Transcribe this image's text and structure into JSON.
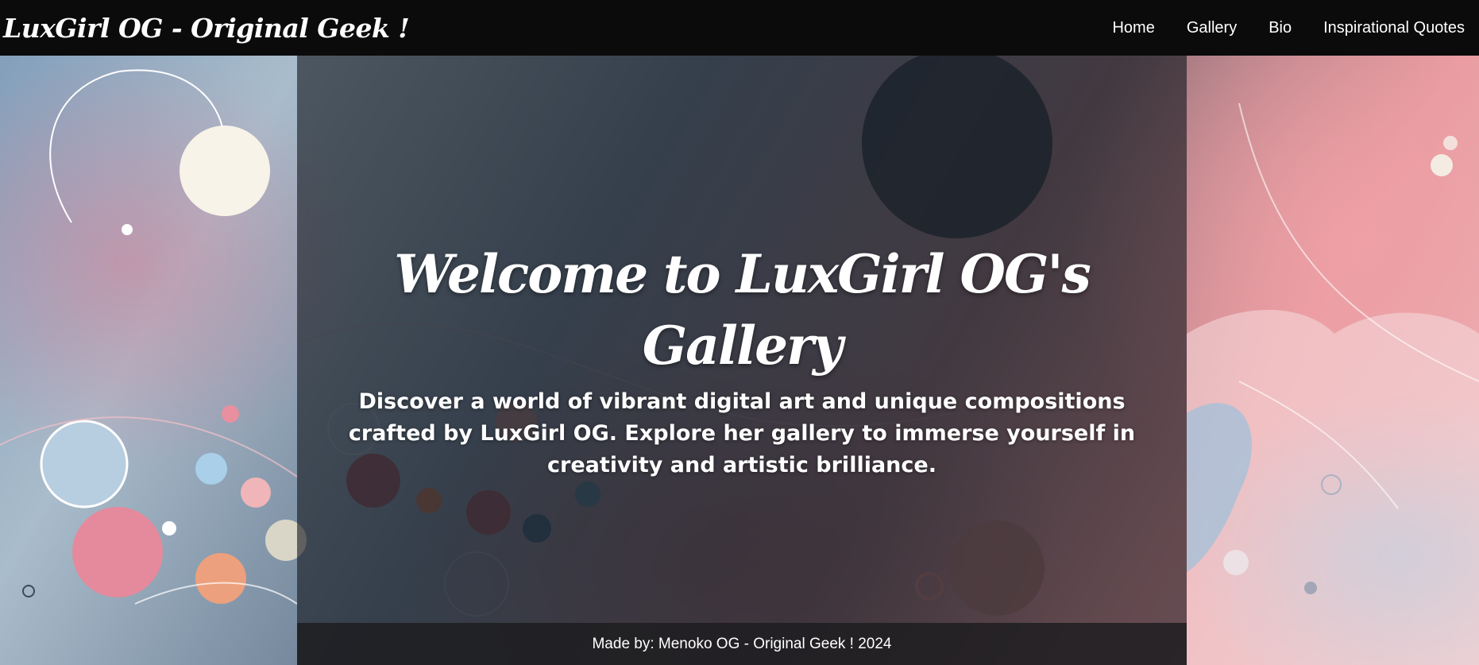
{
  "brand": {
    "title": "LuxGirl OG - Original Geek !"
  },
  "nav": {
    "items": [
      {
        "label": "Home"
      },
      {
        "label": "Gallery"
      },
      {
        "label": "Bio"
      },
      {
        "label": "Inspirational Quotes"
      }
    ]
  },
  "hero": {
    "title": "Welcome to LuxGirl OG's Gallery",
    "text": "Discover a world of vibrant digital art and unique compositions crafted by LuxGirl OG. Explore her gallery to immerse yourself in creativity and artistic brilliance."
  },
  "footer": {
    "text": "Made by: Menoko OG - Original Geek ! 2024"
  },
  "colors": {
    "navbar": "#0b0b0b",
    "panel": "#14181e",
    "text": "#ffffff"
  }
}
